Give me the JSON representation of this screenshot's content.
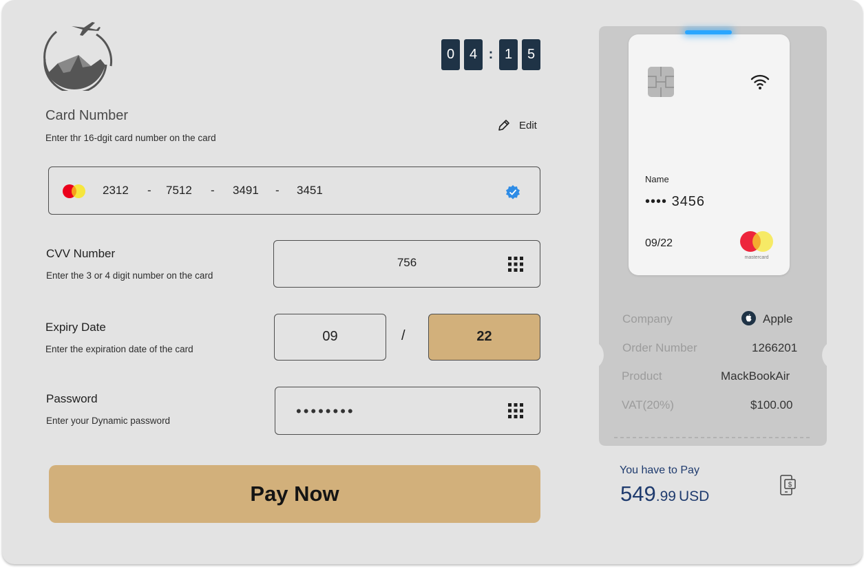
{
  "timer": {
    "digits": [
      "0",
      "4",
      "1",
      "5"
    ],
    "separator": ":"
  },
  "card_number": {
    "title": "Card Number",
    "subtitle": "Enter thr 16-dgit card number on the card",
    "edit_label": "Edit",
    "groups": [
      "2312",
      "7512",
      "3491",
      "3451"
    ],
    "separator": "-",
    "verified_icon": "verified-badge-icon",
    "brand_icon": "mastercard-icon"
  },
  "cvv": {
    "title": "CVV Number",
    "subtitle": "Enter the 3 or 4 digit number on the card",
    "value": "756",
    "keypad_icon": "keypad-icon"
  },
  "expiry": {
    "title": "Expiry Date",
    "subtitle": "Enter the expiration date of the card",
    "month": "09",
    "year": "22",
    "separator": "/"
  },
  "password": {
    "title": "Password",
    "subtitle": "Enter your Dynamic password",
    "masked_value": "••••••••",
    "keypad_icon": "keypad-icon"
  },
  "pay_button": {
    "label": "Pay Now"
  },
  "card_preview": {
    "name_label": "Name",
    "number_masked": "•••• 3456",
    "expiry": "09/22",
    "brand_text": "mastercard"
  },
  "order": {
    "rows": [
      {
        "label": "Company",
        "value": "Apple"
      },
      {
        "label": "Order Number",
        "value": "1266201"
      },
      {
        "label": "Product",
        "value": "MackBookAir"
      },
      {
        "label": "VAT(20%)",
        "value": "$100.00"
      }
    ]
  },
  "total": {
    "label": "You have to Pay",
    "amount_integer": "549",
    "amount_decimal": ".99",
    "currency": "USD"
  },
  "colors": {
    "background": "#e3e3e3",
    "accent_gold": "#d2b07b",
    "timer_navy": "#1f3346",
    "total_blue": "#1f3b6e",
    "receipt_gray": "#c9c9c9"
  }
}
